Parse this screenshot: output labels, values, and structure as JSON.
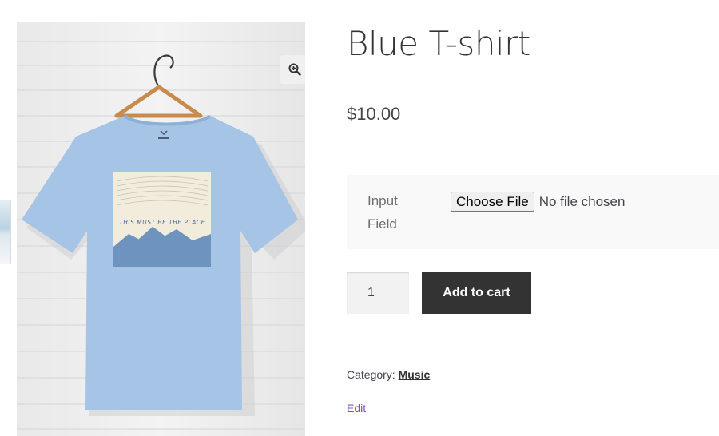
{
  "product": {
    "title": "Blue T-shirt",
    "price": "$10.00",
    "image_print_text": "THIS MUST BE THE PLACE",
    "tshirt_color": "#a5c4e6"
  },
  "addon": {
    "label": "Input Field",
    "file_button": "Choose File",
    "file_status": "No file chosen"
  },
  "cart": {
    "quantity": "1",
    "add_to_cart_label": "Add to cart"
  },
  "meta": {
    "category_prefix": "Category: ",
    "category": "Music",
    "edit_label": "Edit"
  },
  "gallery": {
    "zoom_icon": "zoom-in-icon"
  }
}
